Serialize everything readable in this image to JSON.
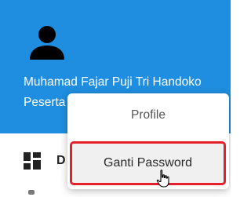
{
  "user": {
    "name": "Muhamad Fajar Puji Tri Handoko",
    "role": "Peserta"
  },
  "sidebar": {
    "items": [
      {
        "label": "D",
        "icon": "dashboard-icon"
      }
    ]
  },
  "menu": {
    "items": [
      {
        "label": "Profile"
      },
      {
        "label": "Ganti Password",
        "highlighted": true
      }
    ]
  },
  "colors": {
    "header_bg": "#1f8ee0",
    "highlight_border": "#e3202b",
    "highlight_bg": "#f0f0f0"
  },
  "icons": {
    "avatar": "person-icon",
    "cursor": "hand-pointer-icon"
  }
}
